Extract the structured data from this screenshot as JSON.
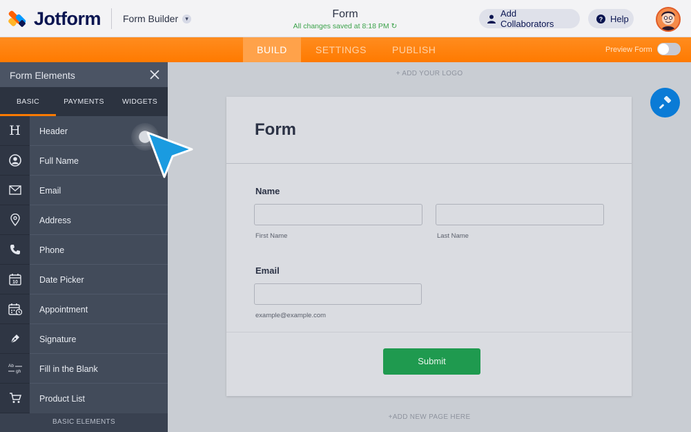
{
  "app": {
    "logo_text": "Jotform",
    "section": "Form Builder",
    "form_title": "Form",
    "save_status": "All changes saved at 8:18 PM",
    "add_collaborators_label": "Add Collaborators",
    "help_label": "Help"
  },
  "nav": {
    "tabs": [
      "BUILD",
      "SETTINGS",
      "PUBLISH"
    ],
    "active_tab": "BUILD",
    "preview_label": "Preview Form",
    "preview_enabled": false
  },
  "sidebar": {
    "title": "Form Elements",
    "tabs": [
      "BASIC",
      "PAYMENTS",
      "WIDGETS"
    ],
    "active_tab": "BASIC",
    "items": [
      {
        "label": "Header",
        "icon": "header-icon"
      },
      {
        "label": "Full Name",
        "icon": "user-circle-icon"
      },
      {
        "label": "Email",
        "icon": "envelope-icon"
      },
      {
        "label": "Address",
        "icon": "location-pin-icon"
      },
      {
        "label": "Phone",
        "icon": "phone-icon"
      },
      {
        "label": "Date Picker",
        "icon": "calendar-icon"
      },
      {
        "label": "Appointment",
        "icon": "appointment-calendar-icon"
      },
      {
        "label": "Signature",
        "icon": "pen-icon"
      },
      {
        "label": "Fill in the Blank",
        "icon": "fill-blank-icon"
      },
      {
        "label": "Product List",
        "icon": "cart-icon"
      }
    ],
    "footer": "BASIC ELEMENTS"
  },
  "canvas": {
    "add_logo": "+ ADD YOUR LOGO",
    "add_page": "+ADD NEW PAGE HERE",
    "form": {
      "title": "Form",
      "name_label": "Name",
      "first_name_sub": "First Name",
      "last_name_sub": "Last Name",
      "email_label": "Email",
      "email_sub": "example@example.com",
      "submit_label": "Submit"
    }
  },
  "colors": {
    "accent": "#ff7a00",
    "brand_navy": "#0a1551",
    "submit_green": "#1f9a4f",
    "cursor_blue": "#1a9be0"
  }
}
